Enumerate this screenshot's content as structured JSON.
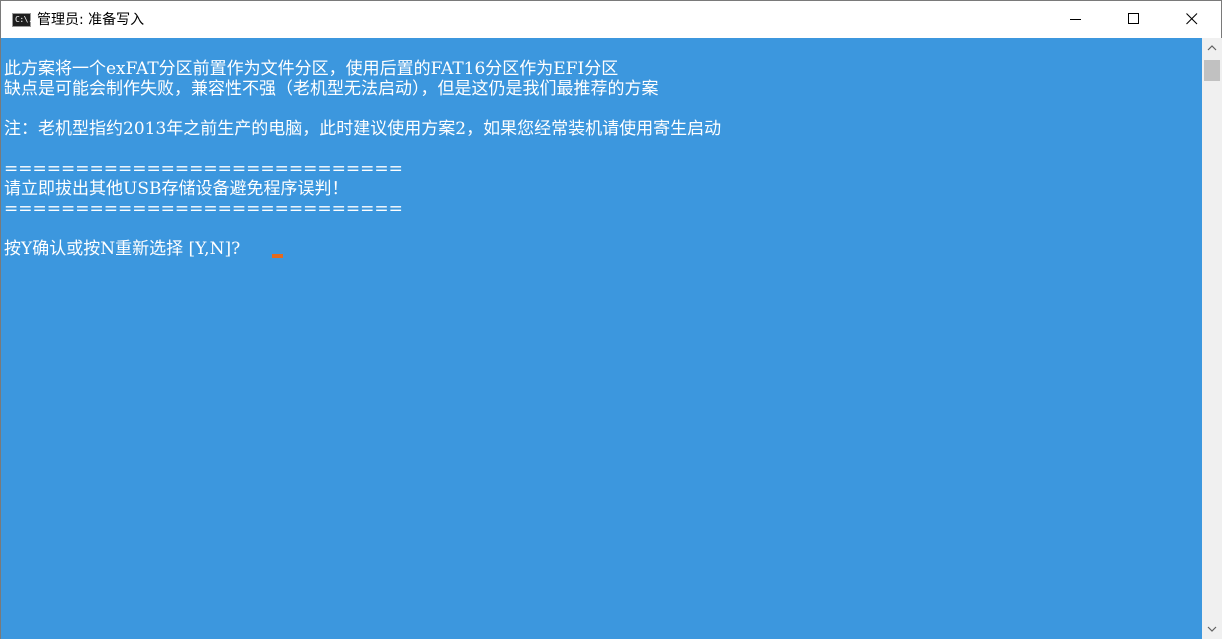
{
  "window": {
    "title": "管理员: 准备写入",
    "icon": "cmd-console-icon",
    "icon_glyph": "C:\\."
  },
  "console": {
    "background": "#3c97de",
    "text_color": "#ffffff",
    "cursor_color": "#e46a1e",
    "lines": [
      "此方案将一个exFAT分区前置作为文件分区，使用后置的FAT16分区作为EFI分区",
      "缺点是可能会制作失败，兼容性不强（老机型无法启动），但是这仍是我们最推荐的方案",
      "注：老机型指约2013年之前生产的电脑，此时建议使用方案2，如果您经常装机请使用寄生启动",
      "==================================================================",
      "请立即拔出其他USB存储设备避免程序误判！",
      "==================================================================",
      "按Y确认或按N重新选择 [Y,N]?"
    ]
  },
  "controls": {
    "minimize": "minimize-icon",
    "maximize": "maximize-icon",
    "close": "close-icon",
    "scroll_up": "chevron-up-icon",
    "scroll_down": "chevron-down-icon"
  }
}
